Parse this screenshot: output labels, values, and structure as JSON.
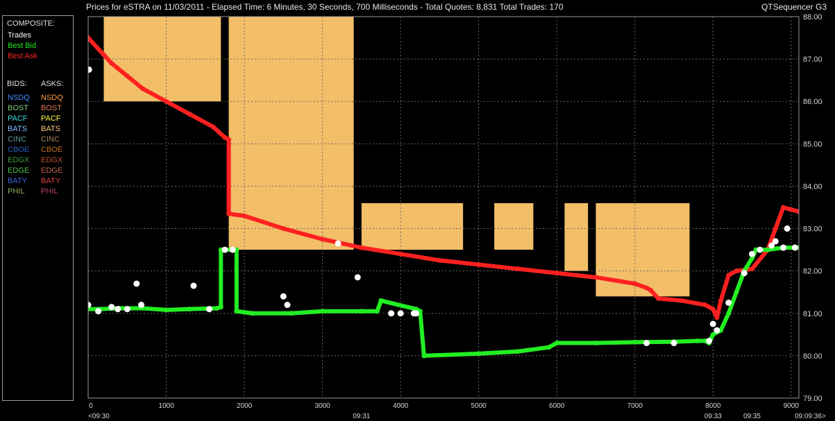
{
  "header": {
    "title": "Prices for  eSTRA  on  11/03/2011  -  Elapsed Time: 6 Minutes, 30 Seconds, 700 Milliseconds  -  Total Quotes: 8,831  Total Trades: 170",
    "app_name": "QTSequencer G3"
  },
  "legend": {
    "composite_label": "COMPOSITE:",
    "composite": [
      {
        "label": "Trades",
        "color": "#ffffff"
      },
      {
        "label": "Best Bid",
        "color": "#22ee22"
      },
      {
        "label": "Best Ask",
        "color": "#ff2020"
      }
    ],
    "bids_label": "BIDS:",
    "asks_label": "ASKS:",
    "rows": [
      {
        "bid": "NSDQ",
        "bid_color": "#3f8cff",
        "ask": "NSDQ",
        "ask_color": "#ff9a40"
      },
      {
        "bid": "BOST",
        "bid_color": "#7fd07f",
        "ask": "BOST",
        "ask_color": "#e07a50"
      },
      {
        "bid": "PACF",
        "bid_color": "#40e0e0",
        "ask": "PACF",
        "ask_color": "#ffff40"
      },
      {
        "bid": "BATS",
        "bid_color": "#80c0ff",
        "ask": "BATS",
        "ask_color": "#ffd080"
      },
      {
        "bid": "CINC",
        "bid_color": "#5fa0a0",
        "ask": "CINC",
        "ask_color": "#a08060"
      },
      {
        "bid": "CBOE",
        "bid_color": "#2060c0",
        "ask": "CBOE",
        "ask_color": "#c07020"
      },
      {
        "bid": "EDGX",
        "bid_color": "#40a040",
        "ask": "EDGX",
        "ask_color": "#c05030"
      },
      {
        "bid": "EDGE",
        "bid_color": "#50c050",
        "ask": "EDGE",
        "ask_color": "#c06050"
      },
      {
        "bid": "BATY",
        "bid_color": "#4060e0",
        "ask": "BATY",
        "ask_color": "#e04040"
      },
      {
        "bid": "PHIL",
        "bid_color": "#90b060",
        "ask": "PHIL",
        "ask_color": "#c04060"
      }
    ]
  },
  "chart_data": {
    "type": "line",
    "title": "",
    "xlim": [
      0,
      9100
    ],
    "ylim": [
      79.0,
      88.0
    ],
    "x_ticks": [
      0,
      1000,
      2000,
      3000,
      4000,
      5000,
      6000,
      7000,
      8000,
      9000
    ],
    "y_ticks": [
      "79.00",
      "80.00",
      "81.00",
      "82.00",
      "83.00",
      "84.00",
      "85.00",
      "86.00",
      "87.00",
      "88.00"
    ],
    "time_labels": [
      {
        "x": 0,
        "label": "<09:30"
      },
      {
        "x": 3500,
        "label": "09:31"
      },
      {
        "x": 8000,
        "label": "09:33"
      },
      {
        "x": 8500,
        "label": "09:35"
      },
      {
        "x": 9000,
        "label": "09:09:36>"
      }
    ],
    "colors": {
      "best_bid": "#22ee22",
      "best_ask": "#ff2020",
      "trades": "#ffffff",
      "ask_fill": "#ffc86e"
    },
    "best_ask": {
      "x": [
        0,
        200,
        300,
        500,
        700,
        1000,
        1300,
        1600,
        1750,
        1800,
        1800,
        2000,
        2500,
        3000,
        3500,
        4000,
        4500,
        5000,
        5500,
        6000,
        6500,
        7000,
        7150,
        7200,
        7300,
        7600,
        7900,
        8000,
        8050,
        8100,
        8200,
        8300,
        8500,
        8700,
        8800,
        8900,
        9000,
        9100
      ],
      "y": [
        87.5,
        87.1,
        86.9,
        86.6,
        86.3,
        86.0,
        85.7,
        85.4,
        85.15,
        85.1,
        83.35,
        83.3,
        83.0,
        82.75,
        82.55,
        82.4,
        82.25,
        82.15,
        82.05,
        81.95,
        81.85,
        81.7,
        81.6,
        81.55,
        81.35,
        81.3,
        81.2,
        81.1,
        80.9,
        81.3,
        81.9,
        82.0,
        82.05,
        82.5,
        83.0,
        83.5,
        83.45,
        83.4
      ]
    },
    "best_bid": {
      "x": [
        0,
        150,
        400,
        700,
        1000,
        1300,
        1650,
        1700,
        1700,
        1850,
        1900,
        1900,
        2100,
        2600,
        3000,
        3500,
        3700,
        3750,
        3750,
        4200,
        4250,
        4300,
        4300,
        5000,
        5500,
        5900,
        6000,
        6500,
        7000,
        7500,
        7800,
        7900,
        7950,
        8000,
        8100,
        8200,
        8300,
        8400,
        8500,
        8550,
        8700,
        8900,
        9100
      ],
      "y": [
        81.1,
        81.1,
        81.12,
        81.12,
        81.08,
        81.1,
        81.12,
        81.15,
        82.5,
        82.5,
        82.5,
        81.05,
        81.0,
        81.0,
        81.05,
        81.05,
        81.05,
        81.3,
        81.3,
        81.1,
        81.05,
        80.0,
        80.0,
        80.05,
        80.1,
        80.2,
        80.3,
        80.3,
        80.32,
        80.33,
        80.35,
        80.35,
        80.3,
        80.5,
        80.6,
        81.0,
        81.5,
        82.0,
        82.3,
        82.5,
        82.5,
        82.55,
        82.55
      ]
    },
    "trades": {
      "x": [
        0,
        10,
        130,
        300,
        380,
        500,
        620,
        680,
        1350,
        1550,
        1750,
        1850,
        2500,
        2550,
        3200,
        3450,
        3880,
        4000,
        4170,
        4200,
        7150,
        7500,
        7950,
        8000,
        8050,
        8200,
        8400,
        8500,
        8600,
        8750,
        8800,
        8900,
        8950,
        9050
      ],
      "y": [
        81.2,
        86.75,
        81.05,
        81.15,
        81.1,
        81.1,
        81.7,
        81.2,
        81.65,
        81.1,
        82.5,
        82.5,
        81.4,
        81.2,
        82.65,
        81.85,
        81.0,
        81.0,
        81.0,
        81.0,
        80.3,
        80.3,
        80.35,
        80.75,
        80.6,
        81.25,
        81.95,
        82.4,
        82.5,
        82.6,
        82.7,
        82.55,
        83.0,
        82.55
      ]
    },
    "ask_blocks": [
      {
        "x0": 1800,
        "x1": 3400,
        "y0": 82.5,
        "y1": 88.0
      },
      {
        "x0": 3500,
        "x1": 4800,
        "y0": 82.5,
        "y1": 83.6
      },
      {
        "x0": 5200,
        "x1": 5700,
        "y0": 82.5,
        "y1": 83.6
      },
      {
        "x0": 6100,
        "x1": 6400,
        "y0": 82.0,
        "y1": 83.6
      },
      {
        "x0": 6500,
        "x1": 7700,
        "y0": 81.4,
        "y1": 83.6
      },
      {
        "x0": 200,
        "x1": 1700,
        "y0": 86.0,
        "y1": 88.0
      }
    ]
  }
}
